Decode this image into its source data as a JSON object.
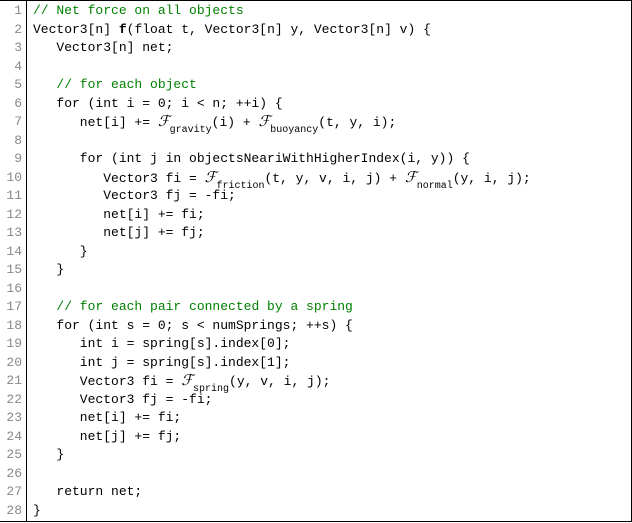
{
  "code": {
    "lines": [
      {
        "n": "1",
        "parts": [
          {
            "t": "// Net force on all objects",
            "c": "comment"
          }
        ]
      },
      {
        "n": "2",
        "parts": [
          {
            "t": "Vector3[n] "
          },
          {
            "t": "f",
            "c": "funcname"
          },
          {
            "t": "(float t, Vector3[n] y, Vector3[n] v) {"
          }
        ]
      },
      {
        "n": "3",
        "parts": [
          {
            "t": "   Vector3[n] net;"
          }
        ]
      },
      {
        "n": "4",
        "parts": [
          {
            "t": ""
          }
        ]
      },
      {
        "n": "5",
        "parts": [
          {
            "t": "   "
          },
          {
            "t": "// for each object",
            "c": "comment"
          }
        ]
      },
      {
        "n": "6",
        "parts": [
          {
            "t": "   for (int i = 0; i < n; ++i) {"
          }
        ]
      },
      {
        "n": "7",
        "parts": [
          {
            "t": "      net[i] += "
          },
          {
            "sf": "gravity"
          },
          {
            "t": "(i) + "
          },
          {
            "sf": "buoyancy"
          },
          {
            "t": "(t, y, i);"
          }
        ]
      },
      {
        "n": "8",
        "parts": [
          {
            "t": ""
          }
        ]
      },
      {
        "n": "9",
        "parts": [
          {
            "t": "      for (int j in objectsNeariWithHigherIndex(i, y)) {"
          }
        ]
      },
      {
        "n": "10",
        "parts": [
          {
            "t": "         Vector3 fi = "
          },
          {
            "sf": "friction"
          },
          {
            "t": "(t, y, v, i, j) + "
          },
          {
            "sf": "normal"
          },
          {
            "t": "(y, i, j);"
          }
        ]
      },
      {
        "n": "11",
        "parts": [
          {
            "t": "         Vector3 fj = -fi;"
          }
        ]
      },
      {
        "n": "12",
        "parts": [
          {
            "t": "         net[i] += fi;"
          }
        ]
      },
      {
        "n": "13",
        "parts": [
          {
            "t": "         net[j] += fj;"
          }
        ]
      },
      {
        "n": "14",
        "parts": [
          {
            "t": "      }"
          }
        ]
      },
      {
        "n": "15",
        "parts": [
          {
            "t": "   }"
          }
        ]
      },
      {
        "n": "16",
        "parts": [
          {
            "t": ""
          }
        ]
      },
      {
        "n": "17",
        "parts": [
          {
            "t": "   "
          },
          {
            "t": "// for each pair connected by a spring",
            "c": "comment"
          }
        ]
      },
      {
        "n": "18",
        "parts": [
          {
            "t": "   for (int s = 0; s < numSprings; ++s) {"
          }
        ]
      },
      {
        "n": "19",
        "parts": [
          {
            "t": "      int i = spring[s].index[0];"
          }
        ]
      },
      {
        "n": "20",
        "parts": [
          {
            "t": "      int j = spring[s].index[1];"
          }
        ]
      },
      {
        "n": "21",
        "parts": [
          {
            "t": "      Vector3 fi = "
          },
          {
            "sf": "spring"
          },
          {
            "t": "(y, v, i, j);"
          }
        ]
      },
      {
        "n": "22",
        "parts": [
          {
            "t": "      Vector3 fj = -fi;"
          }
        ]
      },
      {
        "n": "23",
        "parts": [
          {
            "t": "      net[i] += fi;"
          }
        ]
      },
      {
        "n": "24",
        "parts": [
          {
            "t": "      net[j] += fj;"
          }
        ]
      },
      {
        "n": "25",
        "parts": [
          {
            "t": "   }"
          }
        ]
      },
      {
        "n": "26",
        "parts": [
          {
            "t": ""
          }
        ]
      },
      {
        "n": "27",
        "parts": [
          {
            "t": "   return net;"
          }
        ]
      },
      {
        "n": "28",
        "parts": [
          {
            "t": "}"
          }
        ]
      }
    ],
    "script_glyph": "ℱ"
  }
}
